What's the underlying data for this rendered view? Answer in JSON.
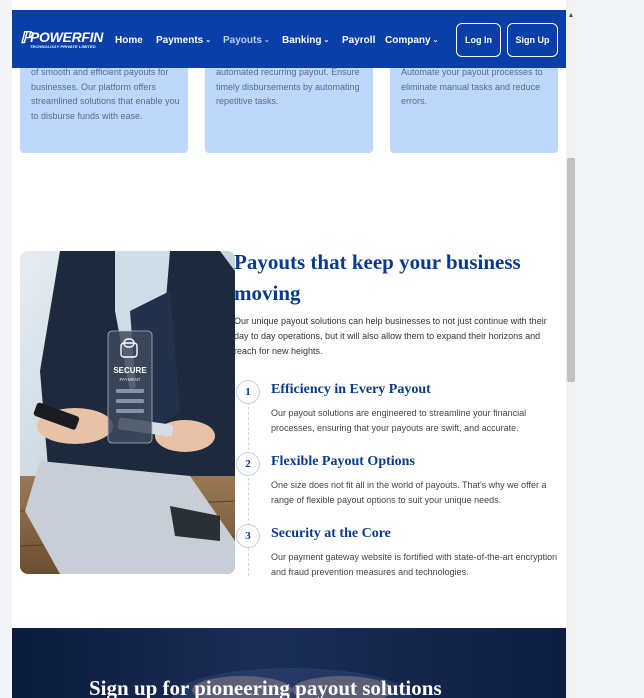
{
  "navbar": {
    "logo_text": "POWERFIN",
    "logo_sub": "TECHNOLOGY PRIVATE LIMITED",
    "items": [
      {
        "label": "Home",
        "chevron": ""
      },
      {
        "label": "Payments",
        "chevron": "⌄"
      },
      {
        "label": "Payouts",
        "chevron": "⌄"
      },
      {
        "label": "Banking",
        "chevron": "⌄"
      },
      {
        "label": "Payroll",
        "chevron": ""
      },
      {
        "label": "Company",
        "chevron": "⌄"
      }
    ],
    "login_label": "Log In",
    "signup_label": "Sign Up"
  },
  "cards": [
    {
      "text": "of smooth and efficient payouts for businesses. Our platform offers streamlined solutions that enable you to disburse funds with ease."
    },
    {
      "text": "automated recurring payout. Ensure timely disbursements by automating repetitive tasks."
    },
    {
      "text": "Automate your payout processes to eliminate manual tasks and reduce errors."
    }
  ],
  "payouts": {
    "title": "Payouts that keep your business moving",
    "description": "Our unique payout solutions can help businesses to not just continue with their day to day operations, but it will also allow them to expand their horizons and reach for new heights.",
    "image_card_text": "SECURE",
    "image_card_sub": "PAYMENT",
    "steps": [
      {
        "num": "1",
        "title": "Efficiency in Every Payout",
        "desc": "Our payout solutions are engineered to streamline your financial processes, ensuring that your payouts are swift, and accurate."
      },
      {
        "num": "2",
        "title": "Flexible Payout Options",
        "desc": "One size does not fit all in the world of payouts. That's why we offer a range of flexible payout options to suit your unique needs."
      },
      {
        "num": "3",
        "title": "Security at the Core",
        "desc": "Our payment gateway website is fortified with state-of-the-art encryption and fraud prevention measures and technologies."
      }
    ]
  },
  "banner": {
    "title": "Sign up for pioneering payout solutions"
  },
  "colors": {
    "brand": "#0a3ea8",
    "heading": "#0a3a8c",
    "card_bg": "#bdd8fb"
  }
}
